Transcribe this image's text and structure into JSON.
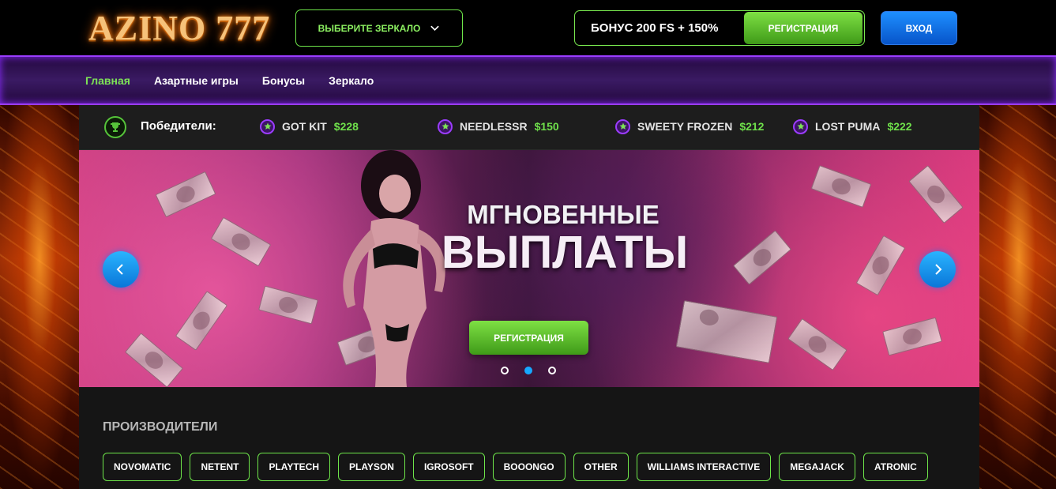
{
  "header": {
    "logo": "AZINO 777",
    "mirror_label": "ВЫБЕРИТЕ ЗЕРКАЛО",
    "bonus_text": "БОНУС 200 FS + 150%",
    "register_label": "РЕГИСТРАЦИЯ",
    "login_label": "ВХОД"
  },
  "nav": {
    "items": [
      {
        "label": "Главная"
      },
      {
        "label": "Азартные игры"
      },
      {
        "label": "Бонусы"
      },
      {
        "label": "Зеркало"
      }
    ]
  },
  "winners": {
    "label": "Победители:",
    "items": [
      {
        "name": "GOT KIT",
        "amount": "$228"
      },
      {
        "name": "NEEDLESSR",
        "amount": "$150"
      },
      {
        "name": "SWEETY FROZEN",
        "amount": "$212"
      },
      {
        "name": "LOST PUMA",
        "amount": "$222"
      }
    ]
  },
  "banner": {
    "title_line1": "МГНОВЕННЫЕ",
    "title_line2": "ВЫПЛАТЫ",
    "register_label": "РЕГИСТРАЦИЯ",
    "slide_count": 3,
    "active_slide": 2
  },
  "providers": {
    "title": "ПРОИЗВОДИТЕЛИ",
    "items": [
      "NOVOMATIC",
      "NETENT",
      "PLAYTECH",
      "PLAYSON",
      "IGROSOFT",
      "BOOONGO",
      "OTHER",
      "WILLIAMS INTERACTIVE",
      "MEGAJACK",
      "ATRONIC"
    ]
  },
  "colors": {
    "accent_green": "#6ee64a",
    "nav_purple": "#3a1a63",
    "login_blue": "#0a76d8"
  }
}
